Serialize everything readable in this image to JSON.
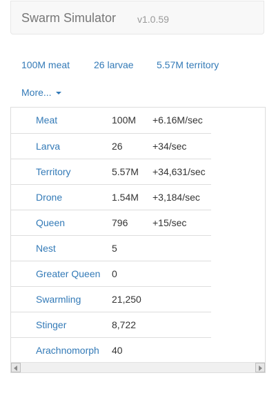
{
  "header": {
    "title": "Swarm Simulator",
    "version": "v1.0.59"
  },
  "summary": [
    {
      "label": "100M meat"
    },
    {
      "label": "26 larvae"
    },
    {
      "label": "5.57M territory"
    }
  ],
  "more_label": "More...",
  "units": [
    {
      "name": "Meat",
      "count": "100M",
      "rate": "+6.16M/sec"
    },
    {
      "name": "Larva",
      "count": "26",
      "rate": "+34/sec"
    },
    {
      "name": "Territory",
      "count": "5.57M",
      "rate": "+34,631/sec"
    },
    {
      "name": "Drone",
      "count": "1.54M",
      "rate": "+3,184/sec"
    },
    {
      "name": "Queen",
      "count": "796",
      "rate": "+15/sec"
    },
    {
      "name": "Nest",
      "count": "5",
      "rate": ""
    },
    {
      "name": "Greater Queen",
      "count": "0",
      "rate": ""
    },
    {
      "name": "Swarmling",
      "count": "21,250",
      "rate": ""
    },
    {
      "name": "Stinger",
      "count": "8,722",
      "rate": ""
    },
    {
      "name": "Arachnomorph",
      "count": "40",
      "rate": ""
    }
  ],
  "colors": {
    "link": "#337ab7",
    "text": "#333333",
    "border": "#dddddd"
  }
}
